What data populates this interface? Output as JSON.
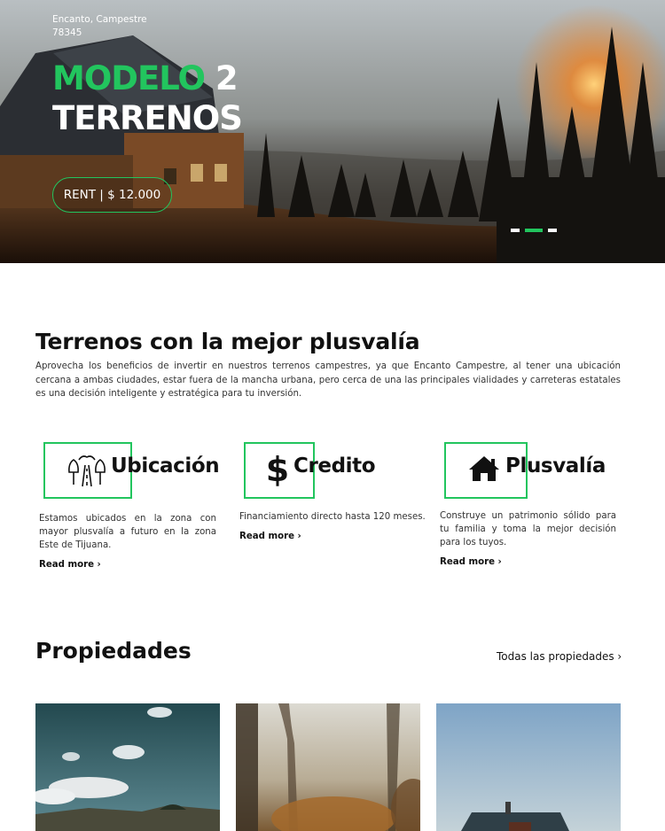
{
  "hero": {
    "address_line1": "Encanto, Campestre",
    "address_line2": "78345",
    "title_green": "MODELO",
    "title_number": " 2",
    "title_line2": "TERRENOS",
    "rent_label": "RENT | $ 12.000",
    "slides": 3,
    "active_slide": 2
  },
  "intro": {
    "title": "Terrenos con la mejor plusvalía",
    "text": "Aprovecha los beneficios de invertir en nuestros terrenos campestres, ya que Encanto Campestre, al tener una ubicación cercana a ambas ciudades, estar fuera de la mancha urbana, pero cerca de una las principales vialidades y carreteras estatales es una decisión inteligente y estratégica para tu inversión."
  },
  "features": [
    {
      "title": "Ubicación",
      "icon": "road-trees-icon",
      "description": "Estamos ubicados en la zona con mayor plusvalía a futuro en la zona Este de Tijuana.",
      "link": "Read more ›"
    },
    {
      "title": "Credito",
      "icon": "dollar-icon",
      "icon_glyph": "$",
      "description": "Financiamiento directo hasta 120 meses.",
      "link": "Read more ›"
    },
    {
      "title": "Plusvalía",
      "icon": "house-icon",
      "description": "Construye un patrimonio sólido para tu familia y toma la mejor decisión para los tuyos.",
      "link": "Read more ›"
    }
  ],
  "properties": {
    "title": "Propiedades",
    "all_link": "Todas las propiedades ›"
  },
  "colors": {
    "accent": "#22c55e",
    "text": "#111111"
  }
}
